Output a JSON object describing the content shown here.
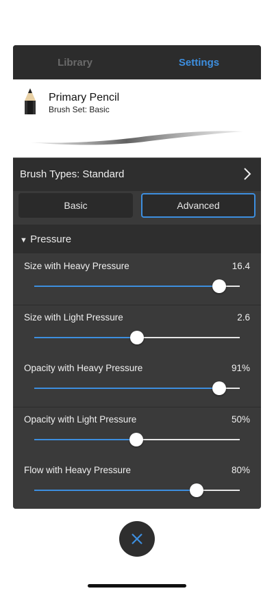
{
  "tabs": {
    "library": "Library",
    "settings": "Settings",
    "active": "Settings"
  },
  "brush": {
    "name": "Primary Pencil",
    "set": "Brush Set: Basic"
  },
  "brush_types": {
    "label": "Brush Types: Standard"
  },
  "mode": {
    "basic": "Basic",
    "advanced": "Advanced",
    "selected": "Advanced"
  },
  "section": {
    "title": "Pressure",
    "arrow": "▼"
  },
  "sliders": [
    {
      "label": "Size with Heavy Pressure",
      "value": "16.4",
      "fraction": 0.9
    },
    {
      "label": "Size with Light Pressure",
      "value": "2.6",
      "fraction": 0.5
    },
    {
      "label": "Opacity with Heavy Pressure",
      "value": "91%",
      "fraction": 0.9
    },
    {
      "label": "Opacity with Light Pressure",
      "value": "50%",
      "fraction": 0.495
    },
    {
      "label": "Flow with Heavy Pressure",
      "value": "80%",
      "fraction": 0.79
    }
  ],
  "colors": {
    "accent": "#3d8fe0",
    "panel": "#3a3a3a",
    "header": "#2c2c2c"
  },
  "icons": {
    "chevron": "chevron-right-icon",
    "close": "close-icon",
    "pencil": "pencil-brush-icon"
  }
}
